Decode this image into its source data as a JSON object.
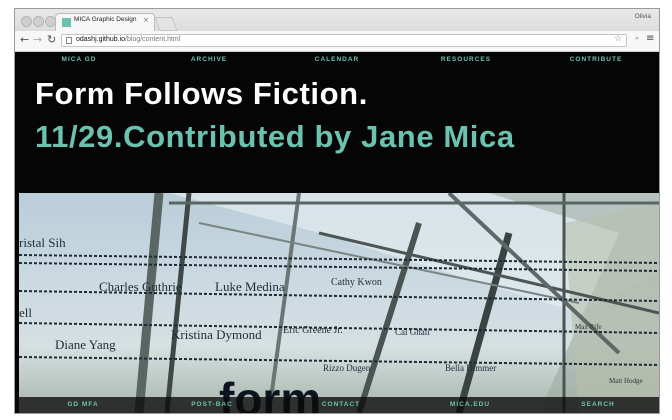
{
  "browser": {
    "tab_title": "MICA Graphic Design",
    "profile_name": "Olivia",
    "url_host": "odashj.github.io",
    "url_path": "/blog/content.html"
  },
  "top_nav": [
    {
      "label": "MICA GD"
    },
    {
      "label": "ARCHIVE"
    },
    {
      "label": "CALENDAR"
    },
    {
      "label": "RESOURCES"
    },
    {
      "label": "CONTRIBUTE"
    }
  ],
  "hero": {
    "title": "Form Follows Fiction.",
    "subtitle": "11/29.Contributed by Jane Mica"
  },
  "photo": {
    "names": [
      "ristal Sih",
      "Charles Guthrie",
      "Luke Medina",
      "Cathy Kwon",
      "ell",
      "Kristina Dymond",
      "Eric Greene Jr.",
      "Cal Ghali",
      "Diane Yang",
      "Rizzo Dugen",
      "Bella Dimmer",
      "Max Rife",
      "Matt Hodge"
    ],
    "sign_text": "form"
  },
  "bottom_nav": [
    {
      "label": "GD MFA"
    },
    {
      "label": "POST-BAC"
    },
    {
      "label": "CONTACT"
    },
    {
      "label": "MICA.EDU"
    },
    {
      "label": "SEARCH"
    }
  ],
  "colors": {
    "accent": "#6cc2b0",
    "page_bg": "#050505",
    "title": "#ffffff"
  }
}
